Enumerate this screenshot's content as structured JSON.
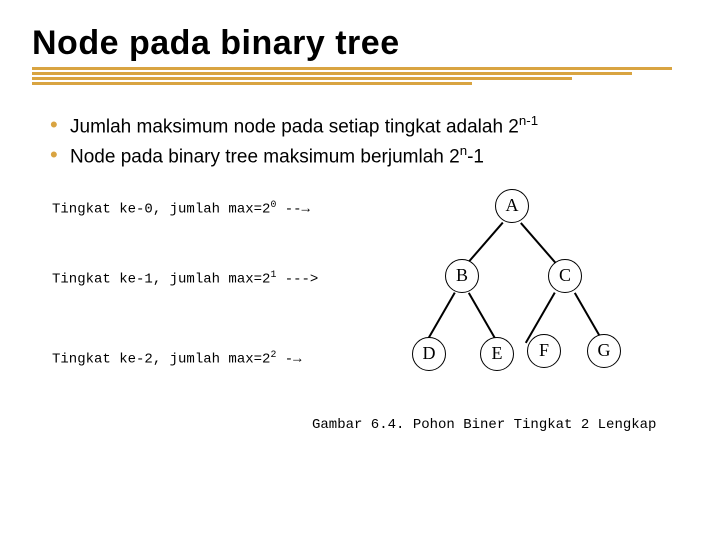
{
  "title": "Node pada binary tree",
  "bullets": {
    "b1_pre": "Jumlah maksimum node pada setiap tingkat adalah 2",
    "b1_sup": "n-1",
    "b2_pre": "Node pada binary tree maksimum berjumlah 2",
    "b2_sup": "n",
    "b2_post": "-1"
  },
  "levels": {
    "l0_a": "Tingkat ke-0, jumlah max=2",
    "l0_sup": "0",
    "l0_b": " --→",
    "l1_a": "Tingkat ke-1, jumlah max=2",
    "l1_sup": "1",
    "l1_b": " --->",
    "l2_a": "Tingkat ke-2, jumlah max=2",
    "l2_sup": "2",
    "l2_b": " -→"
  },
  "nodes": {
    "A": "A",
    "B": "B",
    "C": "C",
    "D": "D",
    "E": "E",
    "F": "F",
    "G": "G"
  },
  "caption": "Gambar 6.4. Pohon Biner Tingkat 2 Lengkap"
}
